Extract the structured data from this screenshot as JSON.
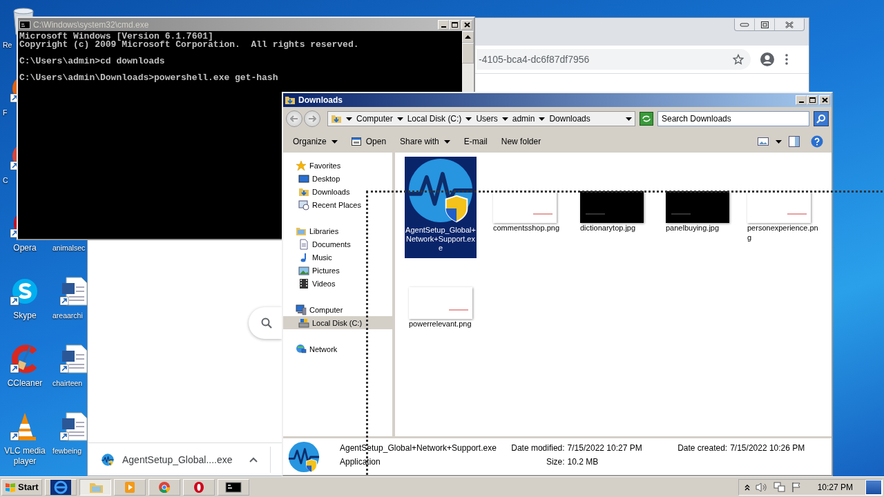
{
  "desktop": {
    "columns": [
      {
        "icons": [
          {
            "label": "Re",
            "kind": "recycle",
            "clipped": true
          },
          {
            "label": "F",
            "kind": "firefox",
            "clipped": true
          },
          {
            "label": "C",
            "kind": "chrome",
            "clipped": true
          },
          {
            "label": "Opera",
            "kind": "opera",
            "clipped": false
          },
          {
            "label": "Skype",
            "kind": "skype",
            "clipped": false
          },
          {
            "label": "CCleaner",
            "kind": "ccleaner",
            "clipped": false
          },
          {
            "label": "VLC media player",
            "kind": "vlc",
            "clipped": false
          }
        ]
      },
      {
        "icons": [
          {
            "label": "animalsec",
            "kind": "covered",
            "clipped": true
          },
          {
            "label": "areaarchi",
            "kind": "word",
            "clipped": true
          },
          {
            "label": "chairteen",
            "kind": "word",
            "clipped": true
          },
          {
            "label": "fewbeing",
            "kind": "word",
            "clipped": true
          }
        ]
      }
    ]
  },
  "browser": {
    "url": "-4105-bca4-dc6f87df7956",
    "download": {
      "name": "AgentSetup_Global....exe"
    }
  },
  "console": {
    "title": "C:\\Windows\\system32\\cmd.exe",
    "blocks": [
      [
        "Microsoft Windows [Version 6.1.7601]",
        "Copyright (c) 2009 Microsoft Corporation.  All rights reserved."
      ],
      [
        "C:\\Users\\admin>cd downloads"
      ],
      [
        "C:\\Users\\admin\\Downloads>powershell.exe get-hash"
      ]
    ]
  },
  "explorer": {
    "title": "Downloads",
    "breadcrumb": [
      "Computer",
      "Local Disk (C:)",
      "Users",
      "admin",
      "Downloads"
    ],
    "search": {
      "placeholder": "Search Downloads"
    },
    "toolbar": [
      {
        "label": "Organize",
        "dropdown": true,
        "has_icon": false
      },
      {
        "label": "Open",
        "dropdown": false,
        "has_icon": true
      },
      {
        "label": "Share with",
        "dropdown": true,
        "has_icon": false
      },
      {
        "label": "E-mail",
        "dropdown": false,
        "has_icon": false
      },
      {
        "label": "New folder",
        "dropdown": false,
        "has_icon": false
      }
    ],
    "nav": [
      {
        "label": "Favorites",
        "kind": "star",
        "selected": false,
        "children": [
          {
            "label": "Desktop",
            "kind": "desktop",
            "selected": false
          },
          {
            "label": "Downloads",
            "kind": "folder",
            "selected": false
          },
          {
            "label": "Recent Places",
            "kind": "recent",
            "selected": false
          }
        ]
      },
      {
        "label": "Libraries",
        "kind": "library",
        "selected": false,
        "children": [
          {
            "label": "Documents",
            "kind": "document",
            "selected": false
          },
          {
            "label": "Music",
            "kind": "music",
            "selected": false
          },
          {
            "label": "Pictures",
            "kind": "pictures",
            "selected": false
          },
          {
            "label": "Videos",
            "kind": "video",
            "selected": false
          }
        ]
      },
      {
        "label": "Computer",
        "kind": "computer",
        "selected": false,
        "children": [
          {
            "label": "Local Disk (C:)",
            "kind": "disk",
            "selected": true
          }
        ]
      },
      {
        "label": "Network",
        "kind": "network",
        "selected": false
      }
    ],
    "files": [
      {
        "name": "AgentSetup_Global+Network+Support.exe",
        "kind": "exe",
        "selected": true
      },
      {
        "name": "commentsshop.png",
        "kind": "image",
        "dark": false,
        "selected": false
      },
      {
        "name": "dictionarytop.jpg",
        "kind": "image",
        "dark": true,
        "selected": false
      },
      {
        "name": "panelbuying.jpg",
        "kind": "image",
        "dark": true,
        "selected": false
      },
      {
        "name": "personexperience.png",
        "kind": "image",
        "dark": false,
        "selected": false
      },
      {
        "name": "powerrelevant.png",
        "kind": "image",
        "dark": false,
        "selected": false
      }
    ],
    "details": {
      "name": "AgentSetup_Global+Network+Support.exe",
      "type": "Application",
      "fields": [
        {
          "label": "Date modified:",
          "value": "7/15/2022 10:27 PM"
        },
        {
          "label": "Size:",
          "value": "10.2 MB"
        },
        {
          "label": "Date created:",
          "value": "7/15/2022 10:26 PM"
        }
      ]
    }
  },
  "taskbar": {
    "start": "Start",
    "apps": [
      {
        "kind": "ie",
        "selected": false
      },
      {
        "kind": "explorer",
        "selected": true
      },
      {
        "kind": "media",
        "selected": false
      },
      {
        "kind": "chrome",
        "selected": false
      },
      {
        "kind": "opera",
        "selected": false
      },
      {
        "kind": "console",
        "selected": false
      }
    ],
    "time": "10:27 PM"
  }
}
